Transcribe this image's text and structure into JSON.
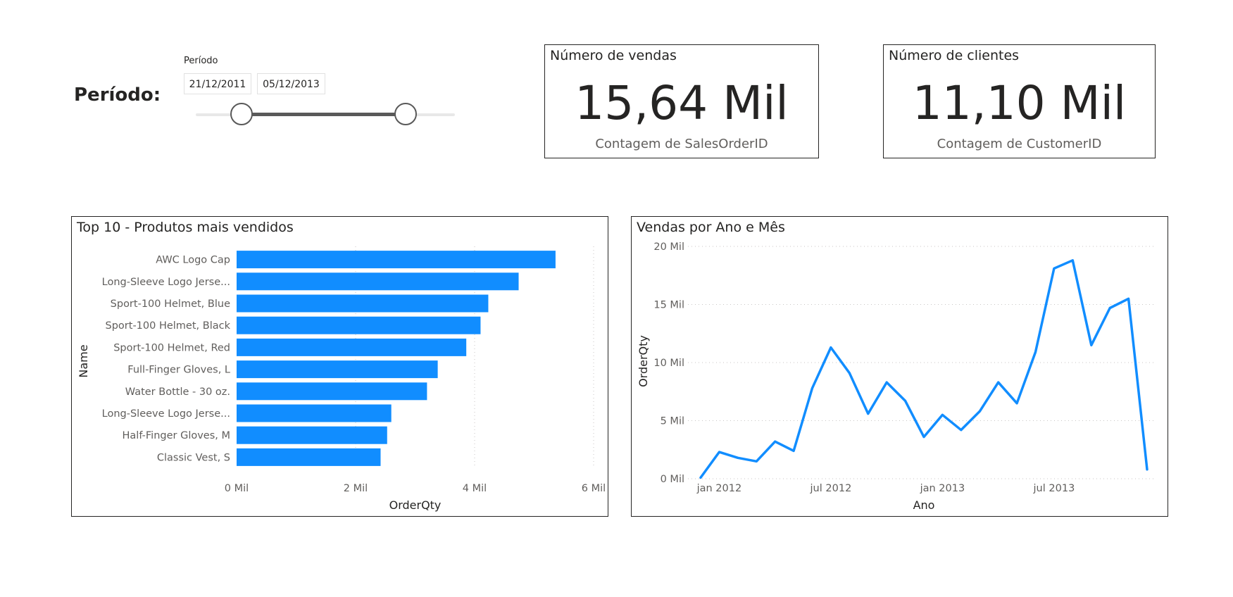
{
  "slicer": {
    "heading": "Período:",
    "title": "Período",
    "start_date": "21/12/2011",
    "end_date": "05/12/2013",
    "range_fraction": [
      0.18,
      0.82
    ]
  },
  "kpis": {
    "vendas": {
      "title": "Número de vendas",
      "value": "15,64 Mil",
      "subtitle": "Contagem de SalesOrderID"
    },
    "clientes": {
      "title": "Número de clientes",
      "value": "11,10 Mil",
      "subtitle": "Contagem de CustomerID"
    }
  },
  "colors": {
    "accent": "#118DFF",
    "border": "#252423",
    "grid": "#c8c6c4",
    "text": "#605e5c"
  },
  "chart_data": [
    {
      "type": "bar",
      "orientation": "horizontal",
      "title": "Top 10 - Produtos mais vendidos",
      "xlabel": "OrderQty",
      "ylabel": "Name",
      "categories": [
        "AWC Logo Cap",
        "Long-Sleeve Logo Jerse...",
        "Sport-100 Helmet, Blue",
        "Sport-100 Helmet, Black",
        "Sport-100 Helmet, Red",
        "Full-Finger Gloves, L",
        "Water Bottle - 30 oz.",
        "Long-Sleeve Logo Jerse...",
        "Half-Finger Gloves, M",
        "Classic Vest, S"
      ],
      "values": [
        5360,
        4740,
        4230,
        4100,
        3860,
        3380,
        3200,
        2600,
        2530,
        2420
      ],
      "xlim": [
        0,
        6000
      ],
      "xticks": [
        0,
        2000,
        4000,
        6000
      ],
      "xtick_labels": [
        "0 Mil",
        "2 Mil",
        "4 Mil",
        "6 Mil"
      ],
      "grid": true
    },
    {
      "type": "line",
      "title": "Vendas por Ano e Mês",
      "xlabel": "Ano",
      "ylabel": "OrderQty",
      "x": [
        "2011-12",
        "2012-01",
        "2012-02",
        "2012-03",
        "2012-04",
        "2012-05",
        "2012-06",
        "2012-07",
        "2012-08",
        "2012-09",
        "2012-10",
        "2012-11",
        "2012-12",
        "2013-01",
        "2013-02",
        "2013-03",
        "2013-04",
        "2013-05",
        "2013-06",
        "2013-07",
        "2013-08",
        "2013-09",
        "2013-10",
        "2013-11",
        "2013-12"
      ],
      "values": [
        100,
        2300,
        1800,
        1500,
        3200,
        2400,
        7800,
        11300,
        9100,
        5600,
        8300,
        6700,
        3600,
        5500,
        4200,
        5800,
        8300,
        6500,
        10900,
        18100,
        18800,
        11500,
        14700,
        15500,
        800
      ],
      "ylim": [
        0,
        20000
      ],
      "yticks": [
        0,
        5000,
        10000,
        15000,
        20000
      ],
      "ytick_labels": [
        "0 Mil",
        "5 Mil",
        "10 Mil",
        "15 Mil",
        "20 Mil"
      ],
      "xtick_labels": [
        {
          "label": "jan 2012",
          "at": "2012-01"
        },
        {
          "label": "jul 2012",
          "at": "2012-07"
        },
        {
          "label": "jan 2013",
          "at": "2013-01"
        },
        {
          "label": "jul 2013",
          "at": "2013-07"
        }
      ],
      "grid": true
    }
  ]
}
